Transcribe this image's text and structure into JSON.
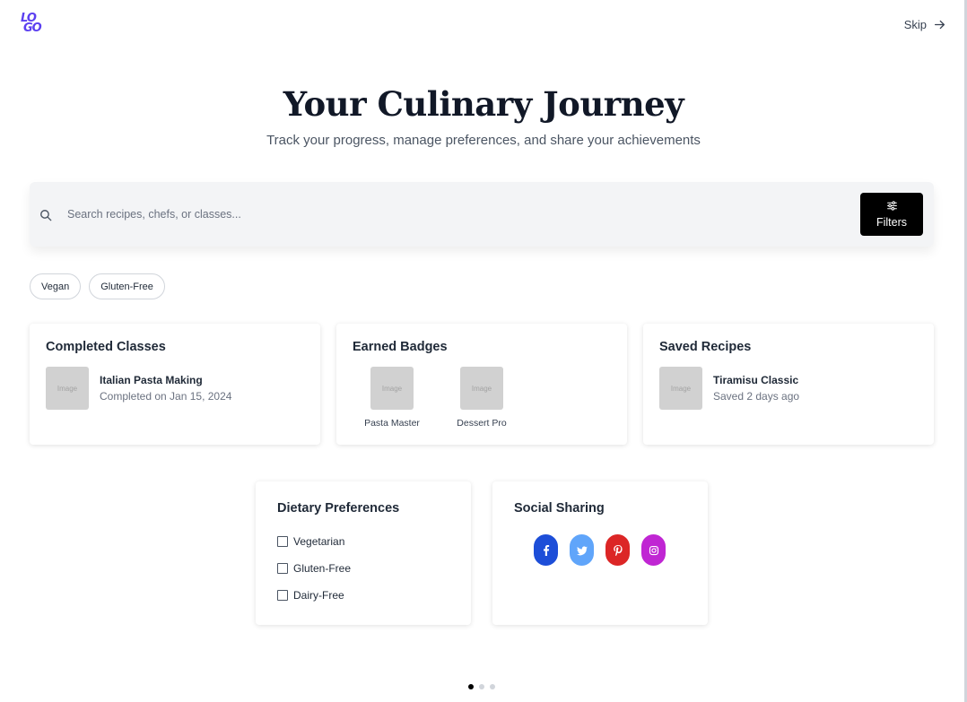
{
  "brand": {
    "logo_top": "LO",
    "logo_bottom": "GO",
    "accent": "#5b3ff0"
  },
  "header": {
    "skip_label": "Skip"
  },
  "hero": {
    "title": "Your Culinary Journey",
    "subtitle": "Track your progress, manage preferences, and share your achievements"
  },
  "search": {
    "placeholder": "Search recipes, chefs, or classes...",
    "value": "",
    "filters_label": "Filters"
  },
  "chips": [
    "Vegan",
    "Gluten-Free"
  ],
  "completed_classes": {
    "title": "Completed Classes",
    "item": {
      "image_alt": "Image",
      "name": "Italian Pasta Making",
      "meta": "Completed on Jan 15, 2024"
    }
  },
  "earned_badges": {
    "title": "Earned Badges",
    "badges": [
      {
        "image_alt": "Image",
        "label": "Pasta Master"
      },
      {
        "image_alt": "Image",
        "label": "Dessert Pro"
      }
    ]
  },
  "saved_recipes": {
    "title": "Saved Recipes",
    "item": {
      "image_alt": "Image",
      "name": "Tiramisu Classic",
      "meta": "Saved 2 days ago"
    }
  },
  "dietary": {
    "title": "Dietary Preferences",
    "options": [
      {
        "label": "Vegetarian",
        "checked": false
      },
      {
        "label": "Gluten-Free",
        "checked": false
      },
      {
        "label": "Dairy-Free",
        "checked": false
      }
    ]
  },
  "social": {
    "title": "Social Sharing",
    "networks": [
      {
        "icon": "facebook-icon",
        "color": "#1d4ed8"
      },
      {
        "icon": "twitter-icon",
        "color": "#60a5fa"
      },
      {
        "icon": "pinterest-icon",
        "color": "#dc2626"
      },
      {
        "icon": "instagram-icon",
        "color": "#c026d3"
      }
    ]
  },
  "pagination": {
    "total": 3,
    "current": 1
  }
}
